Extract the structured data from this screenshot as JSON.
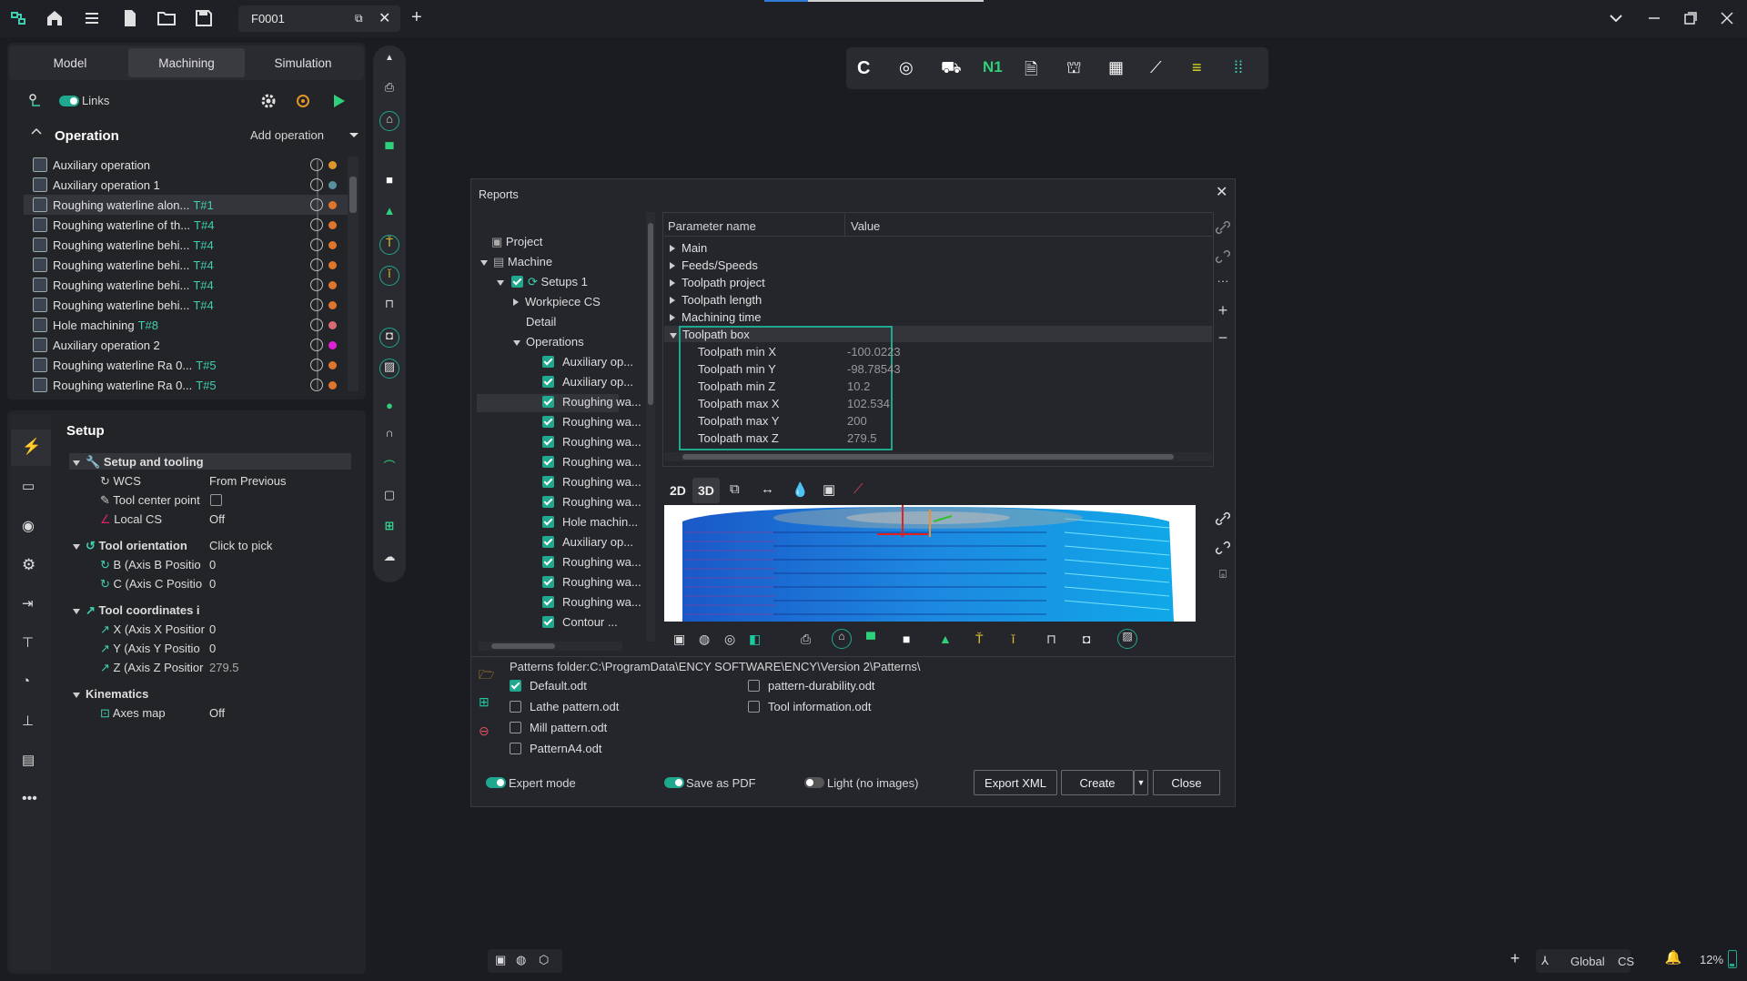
{
  "titlebar": {
    "file_tab": "F0001"
  },
  "left_tabs": [
    "Model",
    "Machining",
    "Simulation"
  ],
  "links_label": "Links",
  "operation_header": {
    "title": "Operation",
    "add_label": "Add operation"
  },
  "operations": [
    {
      "name": "Auxiliary operation",
      "tool": "",
      "dot": "#e0962b"
    },
    {
      "name": "Auxiliary operation 1",
      "tool": "",
      "dot": "#5a8fa0"
    },
    {
      "name": "Roughing waterline alon...",
      "tool": "T#1",
      "dot": "#e0762b"
    },
    {
      "name": "Roughing waterline of th...",
      "tool": "T#4",
      "dot": "#e0762b"
    },
    {
      "name": "Roughing waterline behi...",
      "tool": "T#4",
      "dot": "#e0762b"
    },
    {
      "name": "Roughing waterline behi...",
      "tool": "T#4",
      "dot": "#e0762b"
    },
    {
      "name": "Roughing waterline behi...",
      "tool": "T#4",
      "dot": "#e0762b"
    },
    {
      "name": "Roughing waterline behi...",
      "tool": "T#4",
      "dot": "#e0762b"
    },
    {
      "name": "Hole machining",
      "tool": "T#8",
      "dot": "#d86a70"
    },
    {
      "name": "Auxiliary operation 2",
      "tool": "",
      "dot": "#e020d8"
    },
    {
      "name": "Roughing waterline Ra 0...",
      "tool": "T#5",
      "dot": "#e0762b"
    },
    {
      "name": "Roughing waterline Ra 0...",
      "tool": "T#5",
      "dot": "#e0762b"
    }
  ],
  "setup": {
    "title": "Setup",
    "section1": "Setup and tooling",
    "wcs_label": "WCS",
    "wcs_value": "From Previous",
    "tcp_label": "Tool center point",
    "lcs_label": "Local CS",
    "lcs_value": "Off",
    "tool_orient_label": "Tool orientation",
    "tool_orient_value": "Click to pick",
    "b_label": "B (Axis B Positio",
    "b_value": "0",
    "c_label": "C (Axis C Positio",
    "c_value": "0",
    "tool_coords_label": "Tool coordinates i",
    "x_label": "X (Axis X Positior",
    "x_value": "0",
    "y_label": "Y (Axis Y Positio",
    "y_value": "0",
    "z_label": "Z (Axis Z Positior",
    "z_value": "279.5",
    "kinematics_label": "Kinematics",
    "axes_label": "Axes map",
    "axes_value": "Off"
  },
  "reports": {
    "title": "Reports",
    "tree": {
      "project": "Project",
      "machine": "Machine",
      "setups": "Setups 1",
      "workpiece": "Workpiece CS",
      "detail": "Detail",
      "operations": "Operations",
      "ops": [
        "Auxiliary op...",
        "Auxiliary op...",
        "Roughing wa...",
        "Roughing wa...",
        "Roughing wa...",
        "Roughing wa...",
        "Roughing wa...",
        "Roughing wa...",
        "Hole machin...",
        "Auxiliary op...",
        "Roughing wa...",
        "Roughing wa...",
        "Roughing wa...",
        "Contour ..."
      ]
    },
    "param_header": {
      "name": "Parameter name",
      "value": "Value"
    },
    "groups": [
      "Main",
      "Feeds/Speeds",
      "Toolpath project",
      "Toolpath length",
      "Machining time",
      "Toolpath box"
    ],
    "box_params": [
      {
        "name": "Toolpath min X",
        "value": "-100.0223"
      },
      {
        "name": "Toolpath min Y",
        "value": "-98.78543"
      },
      {
        "name": "Toolpath min Z",
        "value": "10.2"
      },
      {
        "name": "Toolpath max X",
        "value": "102.534"
      },
      {
        "name": "Toolpath max Y",
        "value": "200"
      },
      {
        "name": "Toolpath max Z",
        "value": "279.5"
      }
    ],
    "view_2d": "2D",
    "view_3d": "3D",
    "patterns_folder": "Patterns folder:C:\\ProgramData\\ENCY SOFTWARE\\ENCY\\Version 2\\Patterns\\",
    "patterns_left": [
      {
        "name": "Default.odt",
        "checked": true
      },
      {
        "name": "Lathe pattern.odt",
        "checked": false
      },
      {
        "name": "Mill pattern.odt",
        "checked": false
      },
      {
        "name": "PatternA4.odt",
        "checked": false
      }
    ],
    "patterns_right": [
      {
        "name": "pattern-durability.odt",
        "checked": false
      },
      {
        "name": "Tool information.odt",
        "checked": false
      }
    ],
    "expert_mode": "Expert mode",
    "save_pdf": "Save as PDF",
    "light_mode": "Light (no images)",
    "export_xml": "Export XML",
    "create": "Create",
    "close": "Close"
  },
  "statusbar": {
    "global": "Global",
    "cs": "CS",
    "zoom": "12%"
  },
  "colors": {
    "accent": "#1fa88e",
    "teal_text": "#3fcfb0"
  }
}
